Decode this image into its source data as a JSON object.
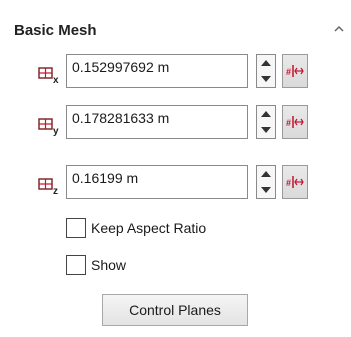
{
  "section": {
    "title": "Basic Mesh",
    "collapse_icon": "chevron-up-icon"
  },
  "fields": [
    {
      "axis": "x",
      "icon": "mesh-x-icon",
      "value": "0.152997692 m"
    },
    {
      "axis": "y",
      "icon": "mesh-y-icon",
      "value": "0.178281633 m"
    },
    {
      "axis": "z",
      "icon": "mesh-z-icon",
      "value": "0.16199 m"
    }
  ],
  "icons": {
    "spin_up": "spin-up-icon",
    "spin_down": "spin-down-icon",
    "flag": "link-values-icon"
  },
  "options": {
    "keep_aspect_ratio": {
      "label": "Keep Aspect Ratio",
      "checked": false
    },
    "show": {
      "label": "Show",
      "checked": false
    }
  },
  "buttons": {
    "control_planes": "Control Planes"
  },
  "colors": {
    "accent_red": "#c8102e"
  }
}
